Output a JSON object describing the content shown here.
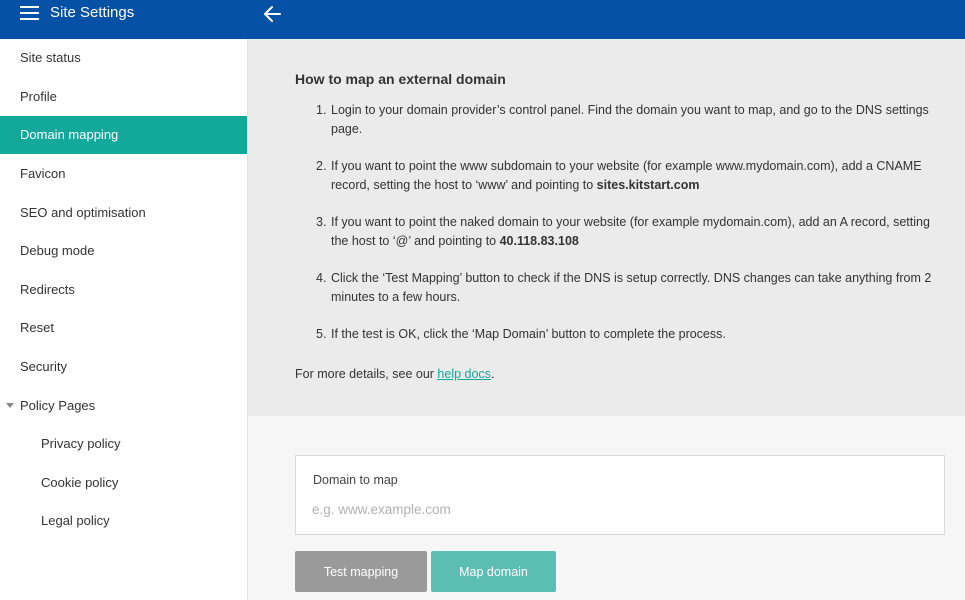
{
  "header": {
    "title": "Site Settings"
  },
  "sidebar": {
    "items": [
      {
        "label": "Site status"
      },
      {
        "label": "Profile"
      },
      {
        "label": "Domain mapping"
      },
      {
        "label": "Favicon"
      },
      {
        "label": "SEO and optimisation"
      },
      {
        "label": "Debug mode"
      },
      {
        "label": "Redirects"
      },
      {
        "label": "Reset"
      },
      {
        "label": "Security"
      },
      {
        "label": "Policy Pages"
      }
    ],
    "policy_pages": [
      {
        "label": "Privacy policy"
      },
      {
        "label": "Cookie policy"
      },
      {
        "label": "Legal policy"
      }
    ],
    "active": "Domain mapping"
  },
  "info": {
    "title": "How to map an external domain",
    "steps": [
      {
        "num": "1.",
        "text": "Login to your domain provider’s control panel. Find the domain you want to map, and go to the DNS settings page."
      },
      {
        "num": "2.",
        "text": "If you want to point the www subdomain to your website (for example www.mydomain.com), add a CNAME record, setting the host to ‘www’ and pointing to ",
        "strong": "sites.kitstart.com"
      },
      {
        "num": "3.",
        "text": "If you want to point the naked domain to your website (for example mydomain.com), add an A record, setting the host to ‘@’ and pointing to ",
        "strong": "40.118.83.108"
      },
      {
        "num": "4.",
        "text": "Click the ‘Test Mapping’ button to check if the DNS is setup correctly. DNS changes can take anything from 2 minutes to a few hours."
      },
      {
        "num": "5.",
        "text": "If the test is OK, click the ‘Map Domain’ button to complete the process."
      }
    ],
    "more_prefix": "For more details, see our ",
    "more_link": "help docs",
    "more_suffix": "."
  },
  "form": {
    "label": "Domain to map",
    "value": "",
    "placeholder": "e.g. www.example.com",
    "test_button": "Test mapping",
    "map_button": "Map domain"
  },
  "colors": {
    "topbar": "#0451a5",
    "accent": "#12a89a",
    "map_button": "#5cbdb3",
    "test_button": "#9a9a9a"
  },
  "icons": {
    "menu": "hamburger-menu-icon",
    "back": "arrow-left-icon",
    "expand": "caret-down-icon"
  }
}
